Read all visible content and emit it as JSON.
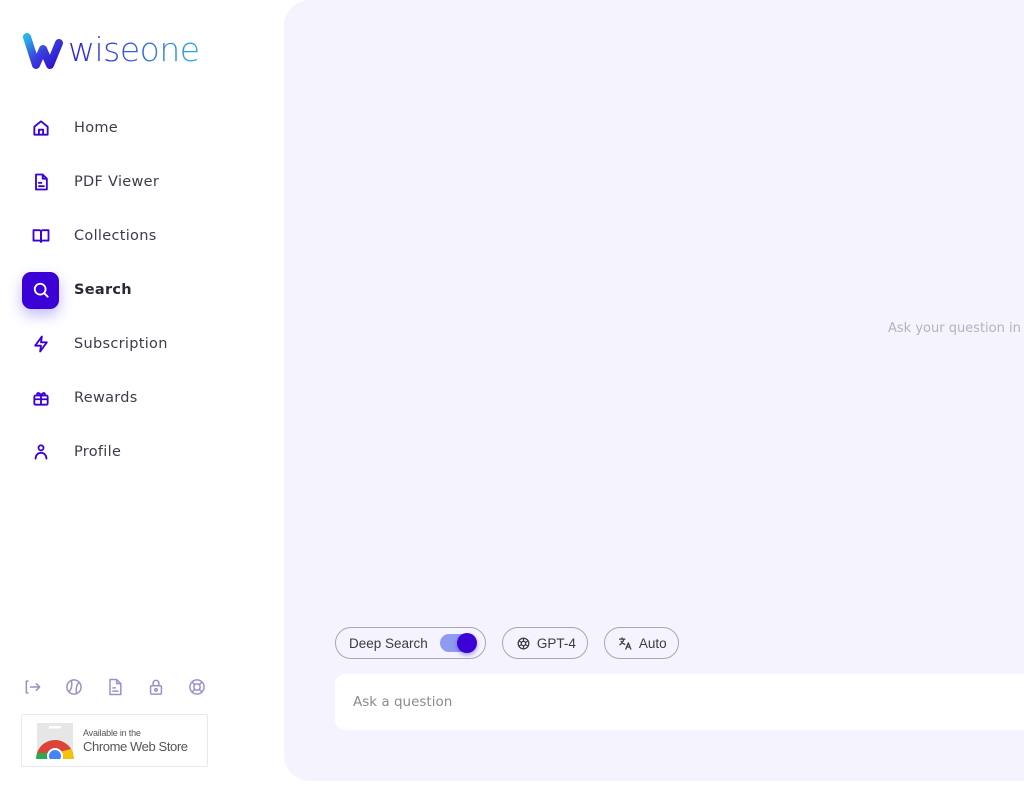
{
  "brand": {
    "name": "wiseone"
  },
  "sidebar": {
    "items": [
      {
        "label": "Home",
        "icon": "home-icon",
        "active": false
      },
      {
        "label": "PDF Viewer",
        "icon": "file-text-icon",
        "active": false
      },
      {
        "label": "Collections",
        "icon": "book-open-icon",
        "active": false
      },
      {
        "label": "Search",
        "icon": "search-icon",
        "active": true
      },
      {
        "label": "Subscription",
        "icon": "lightning-icon",
        "active": false
      },
      {
        "label": "Rewards",
        "icon": "gift-icon",
        "active": false
      },
      {
        "label": "Profile",
        "icon": "user-icon",
        "active": false
      }
    ],
    "footer_icons": [
      "logout-icon",
      "globe-icon",
      "document-icon",
      "lock-icon",
      "lifebuoy-icon"
    ],
    "chrome_store": {
      "small": "Available in the",
      "big": "Chrome Web Store"
    }
  },
  "main": {
    "empty_message": "Ask your question in t",
    "chips": {
      "deep_search": {
        "label": "Deep Search",
        "enabled": true
      },
      "model": {
        "label": "GPT-4"
      },
      "language": {
        "label": "Auto"
      }
    },
    "input": {
      "placeholder": "Ask a question",
      "value": ""
    }
  },
  "colors": {
    "accent": "#3a00d6",
    "icon_inactive": "#9a90c8",
    "main_bg": "#f5f3fe",
    "toggle_track": "#8e9bf0"
  }
}
